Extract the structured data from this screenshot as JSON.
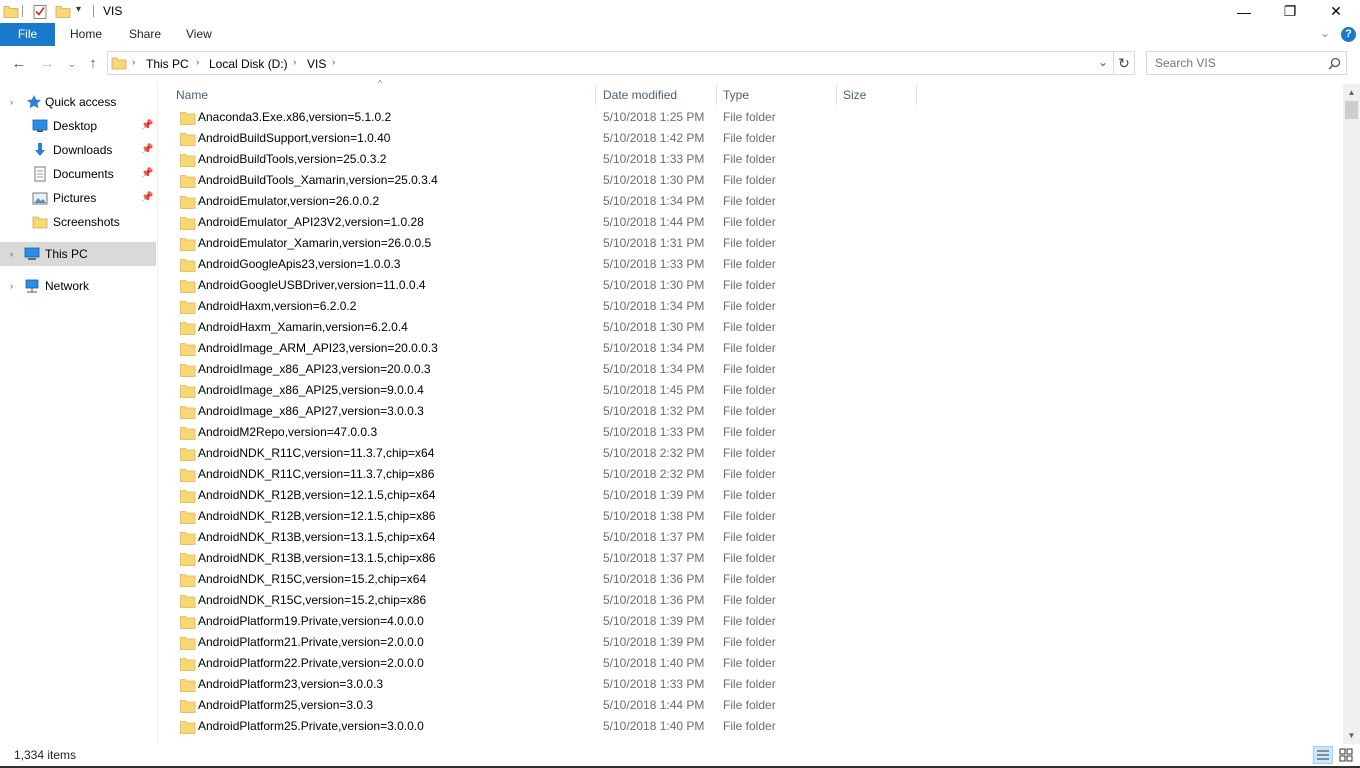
{
  "window": {
    "title": "VIS",
    "minimize_glyph": "—",
    "maximize_glyph": "❐",
    "close_glyph": "✕"
  },
  "ribbon": {
    "tabs": [
      {
        "label": "File"
      },
      {
        "label": "Home"
      },
      {
        "label": "Share"
      },
      {
        "label": "View"
      }
    ],
    "help_glyph": "?",
    "expand_glyph": "⌄"
  },
  "address": {
    "breadcrumb": [
      "This PC",
      "Local Disk (D:)",
      "VIS"
    ],
    "separator": "›",
    "dropdown_glyph": "⌄",
    "refresh_glyph": "↻"
  },
  "search": {
    "placeholder": "Search VIS"
  },
  "sidebar": {
    "quick_access": "Quick access",
    "items": [
      {
        "label": "Desktop",
        "pinned": true
      },
      {
        "label": "Downloads",
        "pinned": true
      },
      {
        "label": "Documents",
        "pinned": true
      },
      {
        "label": "Pictures",
        "pinned": true
      },
      {
        "label": "Screenshots",
        "pinned": false
      }
    ],
    "this_pc": "This PC",
    "network": "Network"
  },
  "columns": {
    "name": "Name",
    "date_modified": "Date modified",
    "type": "Type",
    "size": "Size"
  },
  "files": [
    {
      "name": "Anaconda3.Exe.x86,version=5.1.0.2",
      "date": "5/10/2018 1:25 PM",
      "type": "File folder"
    },
    {
      "name": "AndroidBuildSupport,version=1.0.40",
      "date": "5/10/2018 1:42 PM",
      "type": "File folder"
    },
    {
      "name": "AndroidBuildTools,version=25.0.3.2",
      "date": "5/10/2018 1:33 PM",
      "type": "File folder"
    },
    {
      "name": "AndroidBuildTools_Xamarin,version=25.0.3.4",
      "date": "5/10/2018 1:30 PM",
      "type": "File folder"
    },
    {
      "name": "AndroidEmulator,version=26.0.0.2",
      "date": "5/10/2018 1:34 PM",
      "type": "File folder"
    },
    {
      "name": "AndroidEmulator_API23V2,version=1.0.28",
      "date": "5/10/2018 1:44 PM",
      "type": "File folder"
    },
    {
      "name": "AndroidEmulator_Xamarin,version=26.0.0.5",
      "date": "5/10/2018 1:31 PM",
      "type": "File folder"
    },
    {
      "name": "AndroidGoogleApis23,version=1.0.0.3",
      "date": "5/10/2018 1:33 PM",
      "type": "File folder"
    },
    {
      "name": "AndroidGoogleUSBDriver,version=11.0.0.4",
      "date": "5/10/2018 1:30 PM",
      "type": "File folder"
    },
    {
      "name": "AndroidHaxm,version=6.2.0.2",
      "date": "5/10/2018 1:34 PM",
      "type": "File folder"
    },
    {
      "name": "AndroidHaxm_Xamarin,version=6.2.0.4",
      "date": "5/10/2018 1:30 PM",
      "type": "File folder"
    },
    {
      "name": "AndroidImage_ARM_API23,version=20.0.0.3",
      "date": "5/10/2018 1:34 PM",
      "type": "File folder"
    },
    {
      "name": "AndroidImage_x86_API23,version=20.0.0.3",
      "date": "5/10/2018 1:34 PM",
      "type": "File folder"
    },
    {
      "name": "AndroidImage_x86_API25,version=9.0.0.4",
      "date": "5/10/2018 1:45 PM",
      "type": "File folder"
    },
    {
      "name": "AndroidImage_x86_API27,version=3.0.0.3",
      "date": "5/10/2018 1:32 PM",
      "type": "File folder"
    },
    {
      "name": "AndroidM2Repo,version=47.0.0.3",
      "date": "5/10/2018 1:33 PM",
      "type": "File folder"
    },
    {
      "name": "AndroidNDK_R11C,version=11.3.7,chip=x64",
      "date": "5/10/2018 2:32 PM",
      "type": "File folder"
    },
    {
      "name": "AndroidNDK_R11C,version=11.3.7,chip=x86",
      "date": "5/10/2018 2:32 PM",
      "type": "File folder"
    },
    {
      "name": "AndroidNDK_R12B,version=12.1.5,chip=x64",
      "date": "5/10/2018 1:39 PM",
      "type": "File folder"
    },
    {
      "name": "AndroidNDK_R12B,version=12.1.5,chip=x86",
      "date": "5/10/2018 1:38 PM",
      "type": "File folder"
    },
    {
      "name": "AndroidNDK_R13B,version=13.1.5,chip=x64",
      "date": "5/10/2018 1:37 PM",
      "type": "File folder"
    },
    {
      "name": "AndroidNDK_R13B,version=13.1.5,chip=x86",
      "date": "5/10/2018 1:37 PM",
      "type": "File folder"
    },
    {
      "name": "AndroidNDK_R15C,version=15.2,chip=x64",
      "date": "5/10/2018 1:36 PM",
      "type": "File folder"
    },
    {
      "name": "AndroidNDK_R15C,version=15.2,chip=x86",
      "date": "5/10/2018 1:36 PM",
      "type": "File folder"
    },
    {
      "name": "AndroidPlatform19.Private,version=4.0.0.0",
      "date": "5/10/2018 1:39 PM",
      "type": "File folder"
    },
    {
      "name": "AndroidPlatform21.Private,version=2.0.0.0",
      "date": "5/10/2018 1:39 PM",
      "type": "File folder"
    },
    {
      "name": "AndroidPlatform22.Private,version=2.0.0.0",
      "date": "5/10/2018 1:40 PM",
      "type": "File folder"
    },
    {
      "name": "AndroidPlatform23,version=3.0.0.3",
      "date": "5/10/2018 1:33 PM",
      "type": "File folder"
    },
    {
      "name": "AndroidPlatform25,version=3.0.3",
      "date": "5/10/2018 1:44 PM",
      "type": "File folder"
    },
    {
      "name": "AndroidPlatform25.Private,version=3.0.0.0",
      "date": "5/10/2018 1:40 PM",
      "type": "File folder"
    }
  ],
  "status": {
    "item_count": "1,334 items"
  },
  "colors": {
    "accent": "#1979ca",
    "folder": "#f8d775",
    "folder_dark": "#e0b64d",
    "selection": "#d9d9d9"
  }
}
